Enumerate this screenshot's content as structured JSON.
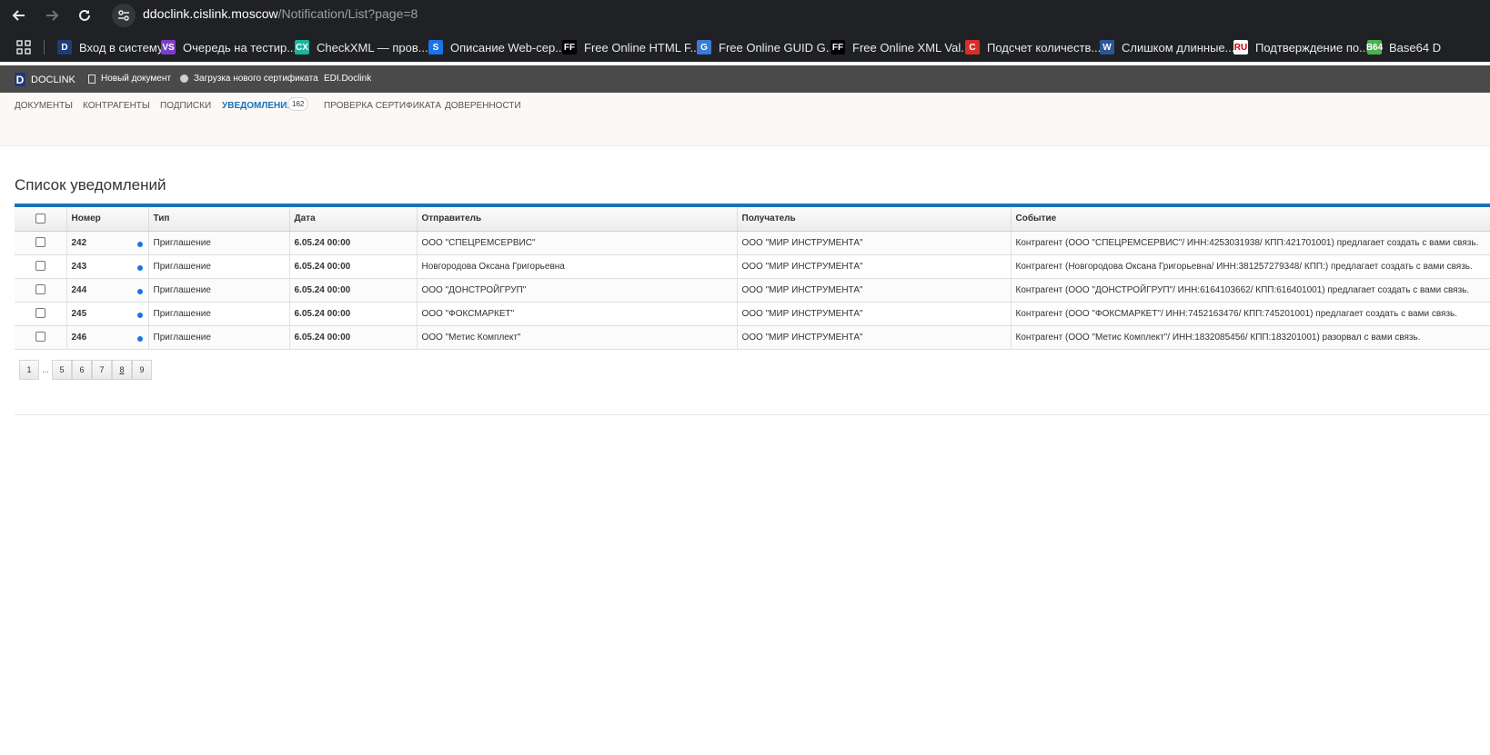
{
  "browser": {
    "url_host": "ddoclink.cislink.moscow",
    "url_path": "/Notification/List?page=8",
    "bookmarks": [
      {
        "label": "Вход в систему",
        "icon": "D",
        "color": "#1c3c7a"
      },
      {
        "label": "Очередь на тестир...",
        "icon": "VS",
        "color": "#7b3fc4"
      },
      {
        "label": "CheckXML — пров...",
        "icon": "CX",
        "color": "#1bb39b"
      },
      {
        "label": "Описание Web-сер...",
        "icon": "S",
        "color": "#1a73e8"
      },
      {
        "label": "Free Online HTML F...",
        "icon": "FF",
        "color": "#000000"
      },
      {
        "label": "Free Online GUID G...",
        "icon": "G",
        "color": "#3a7bd5"
      },
      {
        "label": "Free Online XML Val...",
        "icon": "FF",
        "color": "#000000"
      },
      {
        "label": "Подсчет количеств...",
        "icon": "C",
        "color": "#d93025"
      },
      {
        "label": "Слишком длинные...",
        "icon": "W",
        "color": "#2b5797"
      },
      {
        "label": "Подтверждение по...",
        "icon": "RU",
        "color": "#ffffff"
      },
      {
        "label": "Base64 D",
        "icon": "B64",
        "color": "#4caf50"
      }
    ]
  },
  "header": {
    "logo_text": "DOCLINK",
    "new_doc": "Новый документ",
    "upload_cert": "Загрузка нового сертификата",
    "edi": "EDI.Doclink"
  },
  "nav": {
    "tabs": [
      "ДОКУМЕНТЫ",
      "КОНТРАГЕНТЫ",
      "ПОДПИСКИ",
      "УВЕДОМЛЕНИЯ",
      "ПРОВЕРКА СЕРТИФИКАТА",
      "ДОВЕРЕННОСТИ"
    ],
    "active_tab": "УВЕДОМЛЕНИЯ",
    "notifications_badge": "162"
  },
  "page": {
    "title": "Список уведомлений"
  },
  "table": {
    "columns": [
      "Номер",
      "Тип",
      "Дата",
      "Отправитель",
      "Получатель",
      "Событие"
    ],
    "rows": [
      {
        "num": "242",
        "type": "Приглашение",
        "date": "6.05.24 00:00",
        "sender": "ООО \"СПЕЦРЕМСЕРВИС\"",
        "receiver": "ООО \"МИР ИНСТРУМЕНТА\"",
        "event": "Контрагент (ООО \"СПЕЦРЕМСЕРВИС\"/ ИНН:4253031938/ КПП:421701001) предлагает создать с вами связь."
      },
      {
        "num": "243",
        "type": "Приглашение",
        "date": "6.05.24 00:00",
        "sender": "Новгородова Оксана Григорьевна",
        "receiver": "ООО \"МИР ИНСТРУМЕНТА\"",
        "event": "Контрагент (Новгородова Оксана Григорьевна/ ИНН:381257279348/ КПП:) предлагает создать с вами связь."
      },
      {
        "num": "244",
        "type": "Приглашение",
        "date": "6.05.24 00:00",
        "sender": "ООО \"ДОНСТРОЙГРУП\"",
        "receiver": "ООО \"МИР ИНСТРУМЕНТА\"",
        "event": "Контрагент (ООО \"ДОНСТРОЙГРУП\"/ ИНН:6164103662/ КПП:616401001) предлагает создать с вами связь."
      },
      {
        "num": "245",
        "type": "Приглашение",
        "date": "6.05.24 00:00",
        "sender": "ООО \"ФОКСМАРКЕТ\"",
        "receiver": "ООО \"МИР ИНСТРУМЕНТА\"",
        "event": "Контрагент (ООО \"ФОКСМАРКЕТ\"/ ИНН:7452163476/ КПП:745201001) предлагает создать с вами связь."
      },
      {
        "num": "246",
        "type": "Приглашение",
        "date": "6.05.24 00:00",
        "sender": "ООО \"Метис Комплект\"",
        "receiver": "ООО \"МИР ИНСТРУМЕНТА\"",
        "event": "Контрагент (ООО \"Метис Комплект\"/ ИНН:1832085456/ КПП:183201001) разорвал с вами связь."
      }
    ]
  },
  "pager": {
    "first": "1",
    "ellipsis": "...",
    "pages": [
      "5",
      "6",
      "7",
      "8",
      "9"
    ],
    "current": "8"
  }
}
